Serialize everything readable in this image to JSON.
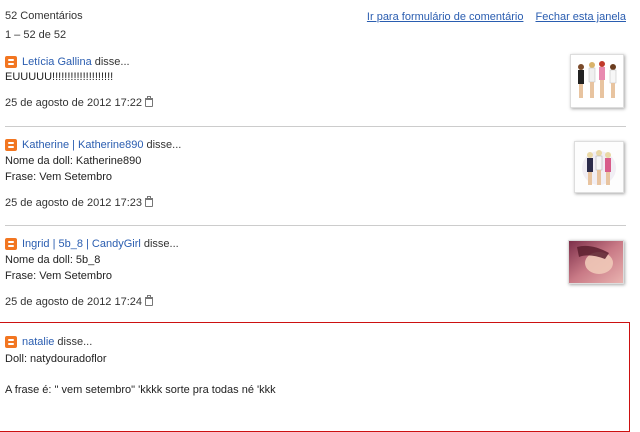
{
  "header": {
    "count": "52 Comentários",
    "range": "1 – 52 de 52",
    "form_link": "Ir para formulário de comentário",
    "close_link": "Fechar esta janela"
  },
  "icons": {
    "author": "blogger-icon",
    "delete": "trash-icon"
  },
  "colors": {
    "link": "#2a5db0",
    "blogger_orange": "#f27621",
    "highlight_border": "#cc1111"
  },
  "disse": "disse...",
  "comments": [
    {
      "author": "Letícia Gallina",
      "lines": [
        "EUUUUU!!!!!!!!!!!!!!!!!!!!"
      ],
      "date": "25 de agosto de 2012 17:22"
    },
    {
      "author": "Katherine | Katherine890",
      "lines": [
        "Nome da doll: Katherine890",
        "Frase: Vem Setembro"
      ],
      "date": "25 de agosto de 2012 17:23"
    },
    {
      "author": "Ingrid | 5b_8 | CandyGirl",
      "lines": [
        "Nome da doll: 5b_8",
        "Frase: Vem Setembro"
      ],
      "date": "25 de agosto de 2012 17:24"
    },
    {
      "author": "natalie",
      "lines": [
        "Doll: natydouradoflor",
        "A frase é: \" vem setembro\" 'kkkk sorte pra todas né 'kkk"
      ]
    }
  ]
}
